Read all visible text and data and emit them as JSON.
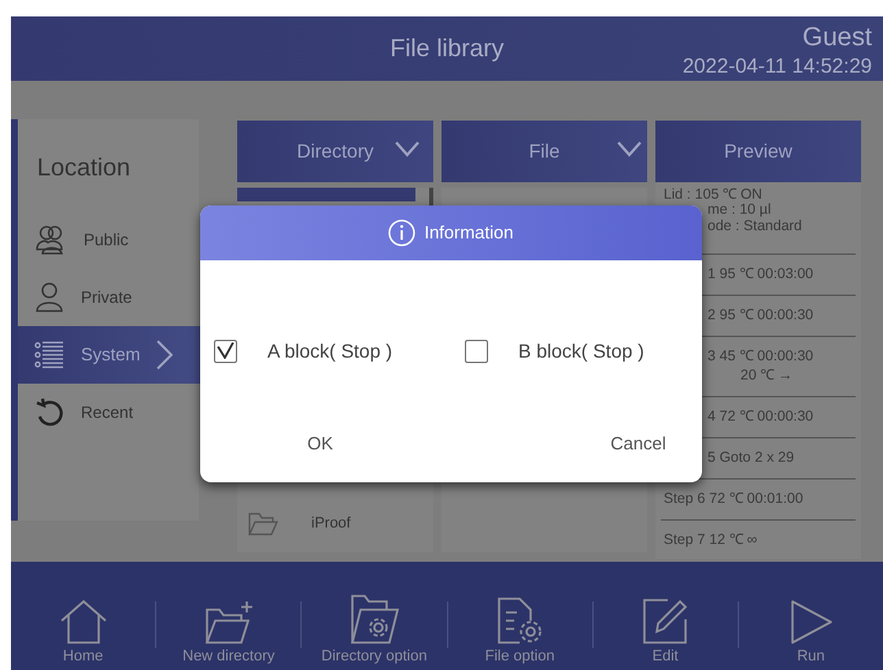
{
  "header": {
    "title": "File library",
    "user": "Guest",
    "datetime": "2022-04-11 14:52:29"
  },
  "location": {
    "title": "Location",
    "items": [
      {
        "label": "Public",
        "selected": false
      },
      {
        "label": "Private",
        "selected": false
      },
      {
        "label": "System",
        "selected": true
      },
      {
        "label": "Recent",
        "selected": false
      }
    ]
  },
  "directory": {
    "header": "Directory",
    "items": [
      {
        "label": "iProof"
      }
    ]
  },
  "file": {
    "header": "File"
  },
  "preview": {
    "header": "Preview",
    "lines": [
      {
        "kind": "info",
        "text": "Lid : 105 ℃  ON"
      },
      {
        "kind": "info_partial",
        "text": "me : 10 µl"
      },
      {
        "kind": "info_partial",
        "text": "ode : Standard"
      },
      {
        "kind": "step_partial",
        "text": "1  95 ℃ 00:03:00"
      },
      {
        "kind": "step_partial",
        "text": "2  95 ℃ 00:00:30"
      },
      {
        "kind": "step_partial",
        "text": "3  45 ℃ 00:00:30"
      },
      {
        "kind": "continuation",
        "text": "20 ℃ →"
      },
      {
        "kind": "step_partial",
        "text": "4  72 ℃ 00:00:30"
      },
      {
        "kind": "step_partial",
        "text": "5   Goto 2    x 29"
      },
      {
        "kind": "step",
        "text": "Step 6  72 ℃ 00:01:00"
      },
      {
        "kind": "step",
        "text": "Step 7  12 ℃ ∞"
      }
    ]
  },
  "dialog": {
    "title": "Information",
    "options": [
      {
        "label": "A block( Stop )",
        "checked": true
      },
      {
        "label": "B block( Stop )",
        "checked": false
      }
    ],
    "buttons": [
      "OK",
      "Cancel"
    ]
  },
  "toolbar": [
    "Home",
    "New directory",
    "Directory option",
    "File option",
    "Edit",
    "Run"
  ]
}
